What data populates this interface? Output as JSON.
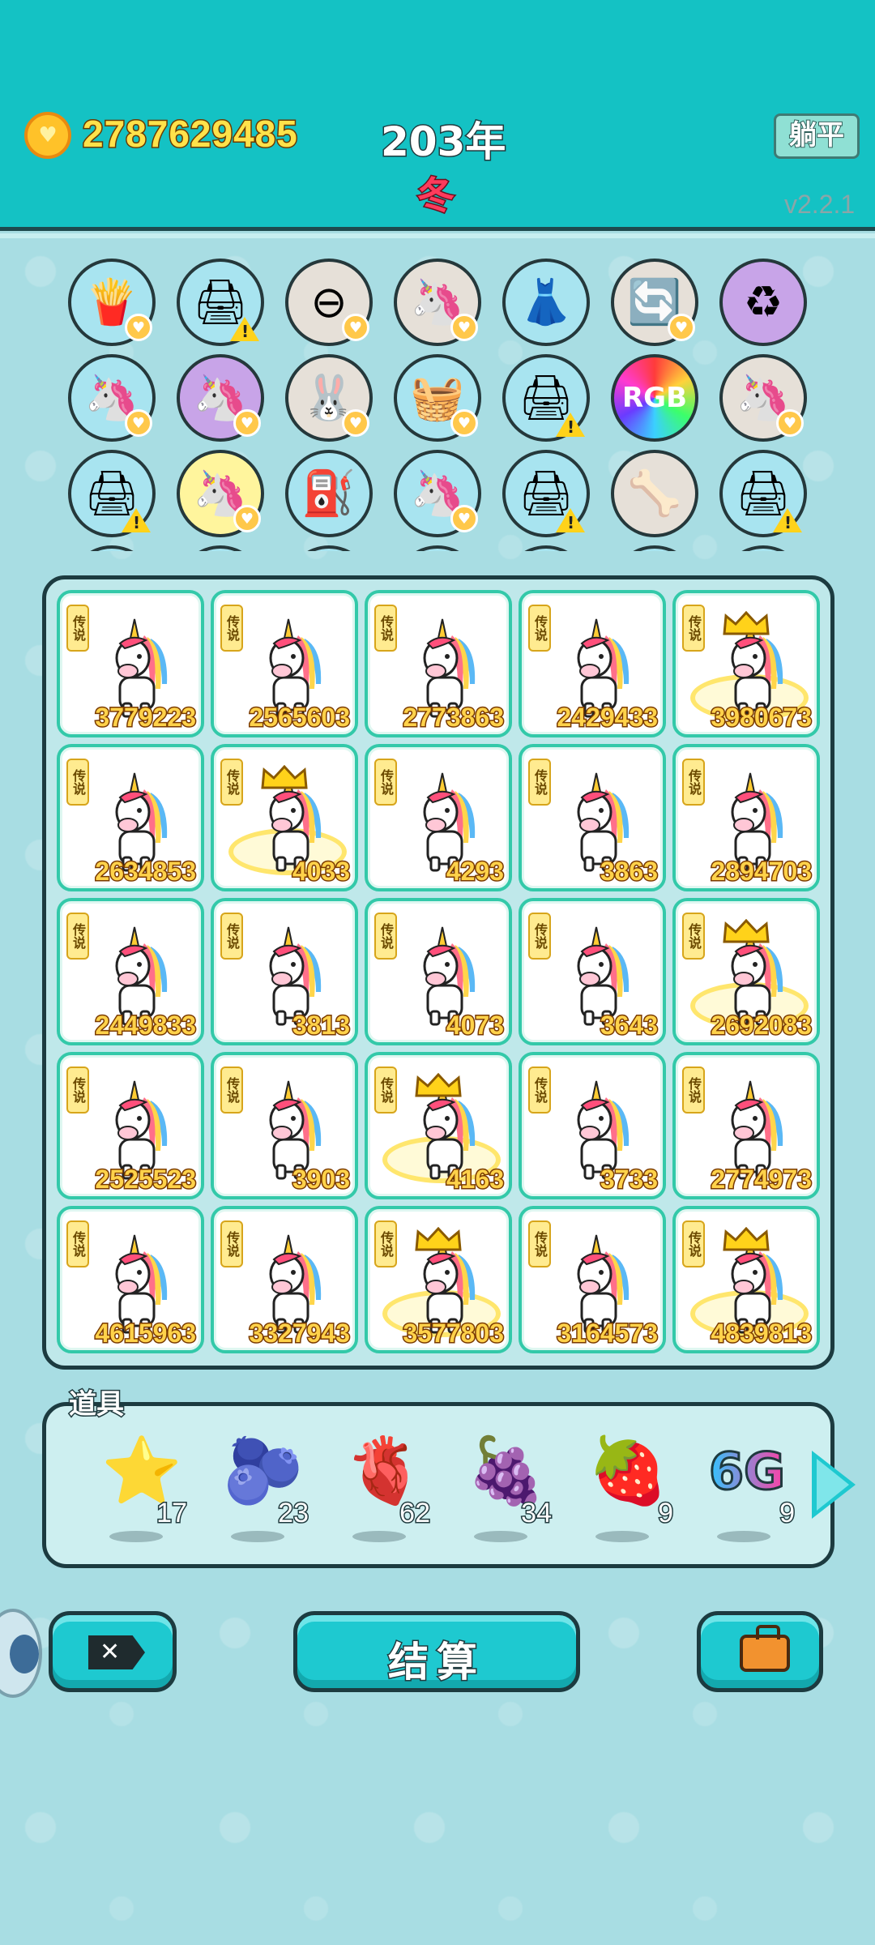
{
  "header": {
    "coins": "2787629485",
    "year": "203年",
    "season": "冬",
    "flat_button": "躺平",
    "version": "v2.2.1"
  },
  "items": [
    {
      "icon": "fries-icon",
      "glyph": "🍟",
      "bg": "#a8e4f0",
      "badge": "heart"
    },
    {
      "icon": "printer-icon",
      "glyph": "🖨",
      "bg": "#a8e4f0",
      "badge": "warn"
    },
    {
      "icon": "minus-sign-icon",
      "glyph": "⊖",
      "bg": "#e6e0d8",
      "badge": "heart"
    },
    {
      "icon": "twin-unicorns-icon",
      "glyph": "🦄",
      "bg": "#e6e0d8",
      "badge": "heart"
    },
    {
      "icon": "pleated-skirt-icon",
      "glyph": "👗",
      "bg": "#a8e4f0",
      "badge": ""
    },
    {
      "icon": "refresh-icon",
      "glyph": "🔄",
      "bg": "#e6e0d8",
      "badge": "heart"
    },
    {
      "icon": "recycle-icon",
      "glyph": "♻",
      "bg": "#c8a4e8",
      "badge": ""
    },
    {
      "icon": "twin-unicorns-icon",
      "glyph": "🦄",
      "bg": "#a8e4f0",
      "badge": "heart"
    },
    {
      "icon": "twin-unicorns-icon",
      "glyph": "🦄",
      "bg": "#c8a4e8",
      "badge": "heart"
    },
    {
      "icon": "rabbit-icon",
      "glyph": "🐰",
      "bg": "#e6e0d8",
      "badge": "heart"
    },
    {
      "icon": "fruit-basket-icon",
      "glyph": "🧺",
      "bg": "#a8e4f0",
      "badge": "heart"
    },
    {
      "icon": "printer-icon",
      "glyph": "🖨",
      "bg": "#a8e4f0",
      "badge": "warn"
    },
    {
      "icon": "rgb-icon",
      "glyph": "RGB",
      "bg": "rainbow",
      "badge": ""
    },
    {
      "icon": "twin-unicorns-icon",
      "glyph": "🦄",
      "bg": "#e6e0d8",
      "badge": "heart"
    },
    {
      "icon": "printer-icon",
      "glyph": "🖨",
      "bg": "#a8e4f0",
      "badge": "warn"
    },
    {
      "icon": "unicorn-icon",
      "glyph": "🦄",
      "bg": "#fff59d",
      "badge": "heart"
    },
    {
      "icon": "pump-icon",
      "glyph": "⛽",
      "bg": "#a8e4f0",
      "badge": ""
    },
    {
      "icon": "twin-unicorns-icon",
      "glyph": "🦄",
      "bg": "#a8e4f0",
      "badge": "heart"
    },
    {
      "icon": "printer-icon",
      "glyph": "🖨",
      "bg": "#a8e4f0",
      "badge": "warn"
    },
    {
      "icon": "pet-food-bowl-icon",
      "glyph": "🦴",
      "bg": "#e6e0d8",
      "badge": ""
    },
    {
      "icon": "printer-icon",
      "glyph": "🖨",
      "bg": "#a8e4f0",
      "badge": "warn"
    }
  ],
  "board": {
    "cells": [
      {
        "tag": "传说",
        "value": "3779223",
        "crowned": false
      },
      {
        "tag": "传说",
        "value": "2565603",
        "crowned": false
      },
      {
        "tag": "传说",
        "value": "2773863",
        "crowned": false
      },
      {
        "tag": "传说",
        "value": "2429433",
        "crowned": false
      },
      {
        "tag": "传说",
        "value": "3980673",
        "crowned": true
      },
      {
        "tag": "传说",
        "value": "2634853",
        "crowned": false
      },
      {
        "tag": "传说",
        "value": "4033",
        "crowned": true
      },
      {
        "tag": "传说",
        "value": "4293",
        "crowned": false
      },
      {
        "tag": "传说",
        "value": "3863",
        "crowned": false
      },
      {
        "tag": "传说",
        "value": "2894703",
        "crowned": false
      },
      {
        "tag": "传说",
        "value": "2449833",
        "crowned": false
      },
      {
        "tag": "传说",
        "value": "3813",
        "crowned": false
      },
      {
        "tag": "传说",
        "value": "4073",
        "crowned": false
      },
      {
        "tag": "传说",
        "value": "3643",
        "crowned": false
      },
      {
        "tag": "传说",
        "value": "2692083",
        "crowned": true
      },
      {
        "tag": "传说",
        "value": "2525523",
        "crowned": false
      },
      {
        "tag": "传说",
        "value": "3903",
        "crowned": false
      },
      {
        "tag": "传说",
        "value": "4163",
        "crowned": true
      },
      {
        "tag": "传说",
        "value": "3733",
        "crowned": false
      },
      {
        "tag": "传说",
        "value": "2774973",
        "crowned": false
      },
      {
        "tag": "传说",
        "value": "4615963",
        "crowned": false
      },
      {
        "tag": "传说",
        "value": "3327943",
        "crowned": false
      },
      {
        "tag": "传说",
        "value": "3577803",
        "crowned": true
      },
      {
        "tag": "传说",
        "value": "3164573",
        "crowned": false
      },
      {
        "tag": "传说",
        "value": "4839813",
        "crowned": true
      }
    ]
  },
  "props": {
    "title": "道具",
    "items": [
      {
        "icon": "star-icon",
        "glyph": "⭐",
        "count": "17"
      },
      {
        "icon": "blueberry-icon",
        "glyph": "🫐",
        "count": "23"
      },
      {
        "icon": "liver-icon",
        "glyph": "🫀",
        "count": "62"
      },
      {
        "icon": "bayberry-icon",
        "glyph": "🍇",
        "count": "34"
      },
      {
        "icon": "strawberry-icon",
        "glyph": "🍓",
        "count": "9"
      },
      {
        "icon": "6g-icon",
        "glyph": "6G",
        "count": "9"
      }
    ]
  },
  "buttons": {
    "close_glyph": "✕",
    "settle_label": "结算"
  }
}
